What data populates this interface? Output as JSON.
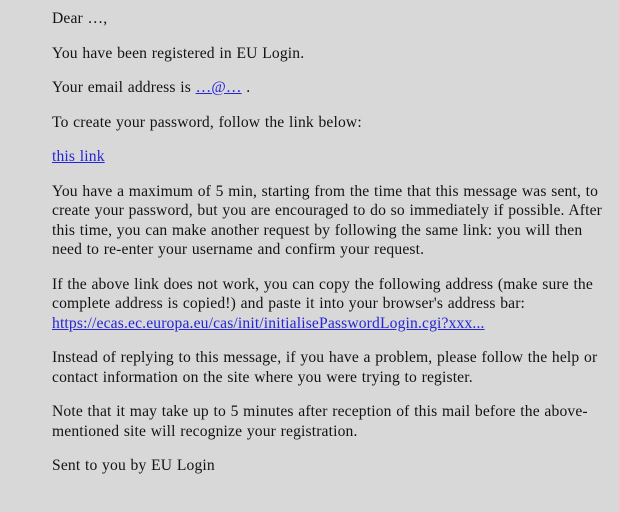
{
  "document": {
    "type": "email-body",
    "background_color": "#d8d8d8",
    "text_color": "#131313",
    "link_color": "#2424d8",
    "paragraphs": {
      "salutation": "Dear …,",
      "registered_notice": "You have been registered in EU Login.",
      "email_address_prefix": "Your email address is ",
      "email_address_link": "…@…",
      "email_address_suffix": " .",
      "create_password_intro": "To create your password, follow the link below:",
      "this_link_label": "this link",
      "expiry_notice": "You have a maximum of 5 min, starting from the time that this message was sent, to create your password, but you are encouraged to do so immediately if possible.  After this time, you can make another request by following the same link: you will then need to re-enter your username and confirm your request.",
      "fallback_address_intro": "If the above link does not work, you can copy the following address (make sure the complete address is copied!) and paste it into your browser's address bar:",
      "fallback_url": "https://ecas.ec.europa.eu/cas/init/initialisePasswordLogin.cgi?xxx...",
      "no_reply_notice": "Instead of replying to this message, if you have a problem, please follow the help or contact information on the site where you were trying to register.",
      "propagation_notice": "Note that it may take up to 5 minutes after reception of this mail before the above-mentioned site will recognize your registration.",
      "signature": "Sent to you by EU Login"
    }
  }
}
